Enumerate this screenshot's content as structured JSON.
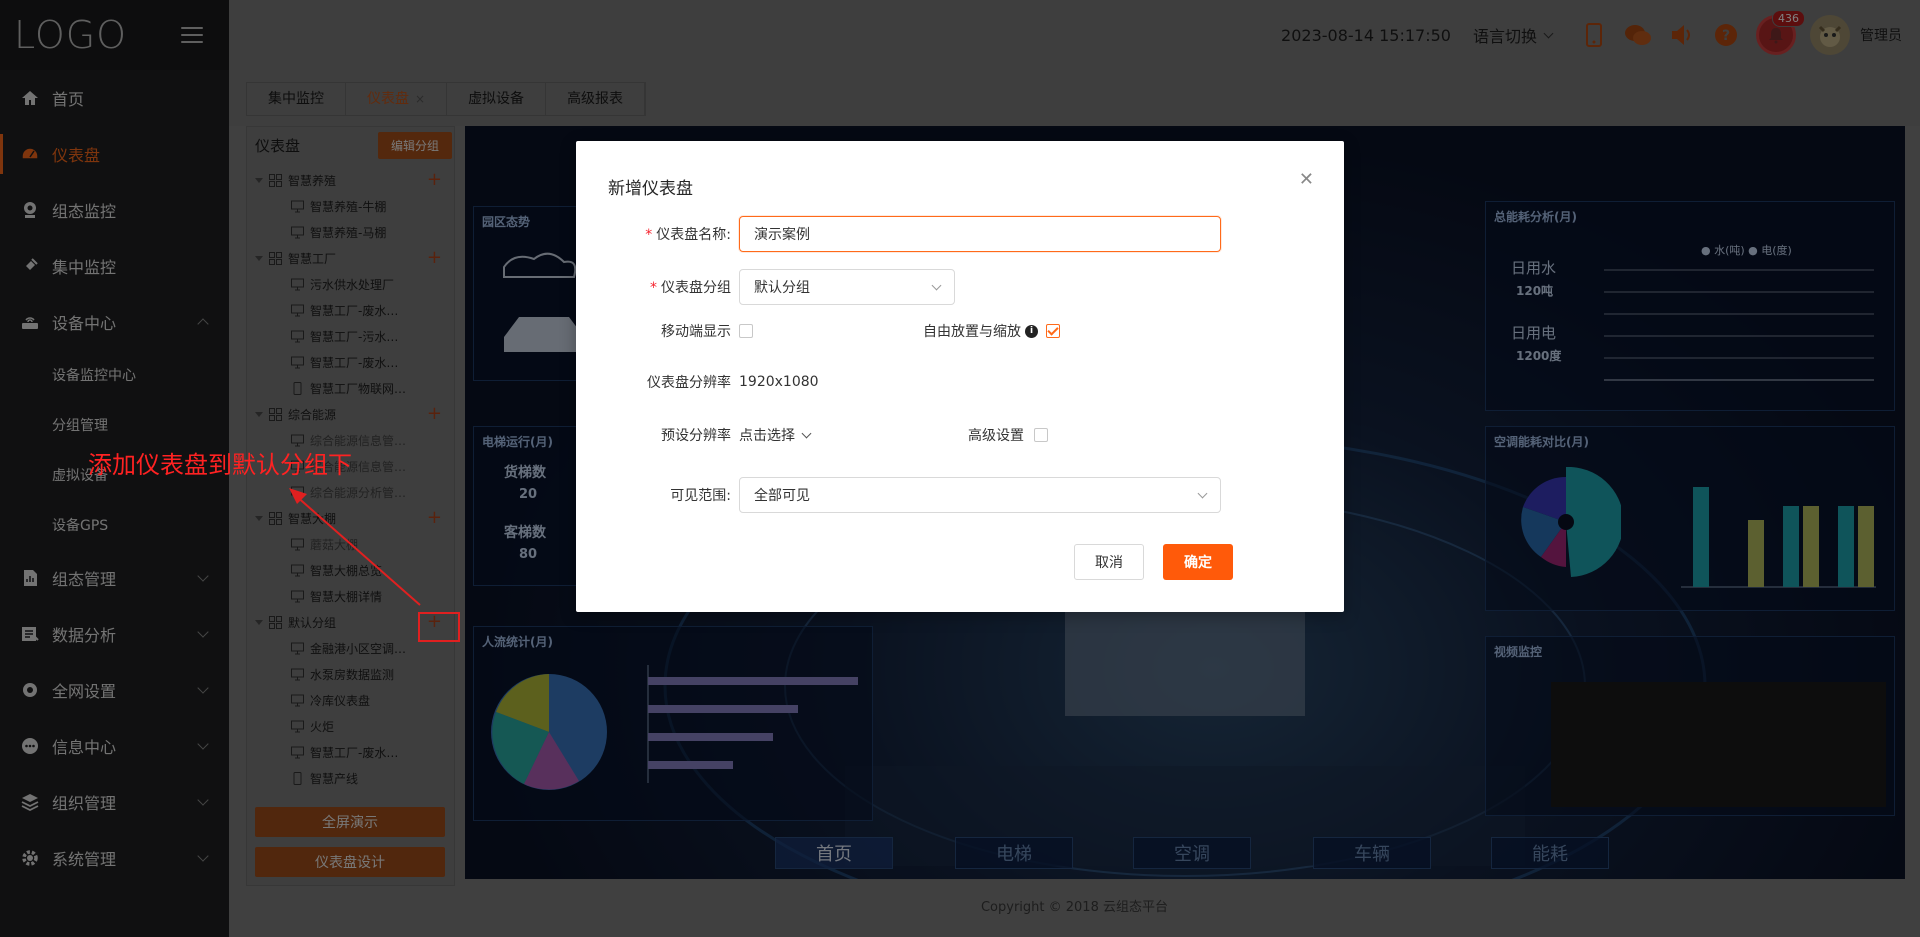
{
  "sidebar": {
    "logo": "LOGO",
    "menu": [
      {
        "label": "首页"
      },
      {
        "label": "仪表盘"
      },
      {
        "label": "组态监控"
      },
      {
        "label": "集中监控"
      },
      {
        "label": "设备中心"
      },
      {
        "label": "组态管理"
      },
      {
        "label": "数据分析"
      },
      {
        "label": "全网设置"
      },
      {
        "label": "信息中心"
      },
      {
        "label": "组织管理"
      },
      {
        "label": "系统管理"
      }
    ],
    "submenu": [
      {
        "label": "设备监控中心"
      },
      {
        "label": "分组管理"
      },
      {
        "label": "虚拟设备"
      },
      {
        "label": "设备GPS"
      }
    ]
  },
  "header": {
    "datetime": "2023-08-14 15:17:50",
    "language": "语言切换",
    "badge_count": "436",
    "user": "管理员"
  },
  "tabs": [
    {
      "label": "集中监控"
    },
    {
      "label": "仪表盘"
    },
    {
      "label": "虚拟设备"
    },
    {
      "label": "高级报表"
    }
  ],
  "tree": {
    "title": "仪表盘",
    "edit_group": "编辑分组",
    "nodes": [
      {
        "label": "智慧养殖"
      },
      {
        "label": "智慧养殖-牛棚"
      },
      {
        "label": "智慧养殖-马棚"
      },
      {
        "label": "智慧工厂"
      },
      {
        "label": "污水供水处理厂"
      },
      {
        "label": "智慧工厂-废水…"
      },
      {
        "label": "智慧工厂-污水…"
      },
      {
        "label": "智慧工厂-废水…"
      },
      {
        "label": "智慧工厂物联网…"
      },
      {
        "label": "综合能源"
      },
      {
        "label": "综合能源信息管…"
      },
      {
        "label": "综合能源信息管…"
      },
      {
        "label": "综合能源分析管…"
      },
      {
        "label": "智慧大棚"
      },
      {
        "label": "蘑菇大棚"
      },
      {
        "label": "智慧大棚总览"
      },
      {
        "label": "智慧大棚详情"
      },
      {
        "label": "默认分组"
      },
      {
        "label": "金融港小区空调…"
      },
      {
        "label": "水泵房数据监测"
      },
      {
        "label": "冷库仪表盘"
      },
      {
        "label": "火炬"
      },
      {
        "label": "智慧工厂-废水…"
      },
      {
        "label": "智慧产线"
      }
    ],
    "fullscreen_btn": "全屏演示",
    "design_btn": "仪表盘设计"
  },
  "annotation": "添加仪表盘到默认分组下",
  "dashboard": {
    "panels": [
      {
        "title": "园区态势"
      },
      {
        "title": "电梯运行(月)"
      },
      {
        "title": "人流统计(月)"
      },
      {
        "title": "总能耗分析(月)"
      },
      {
        "title": "空调能耗对比(月)"
      },
      {
        "title": "视频监控"
      }
    ],
    "elevator": {
      "freight_label": "货梯数",
      "freight_value": "20",
      "passenger_label": "客梯数",
      "passenger_value": "80"
    },
    "energy": {
      "water_label": "日用水",
      "water_value": "120吨",
      "power_label": "日用电",
      "power_value": "1200度",
      "legend": "● 水(吨) ● 电(度)"
    },
    "nav": [
      {
        "label": "首页"
      },
      {
        "label": "电梯"
      },
      {
        "label": "空调"
      },
      {
        "label": "车辆"
      },
      {
        "label": "能耗"
      }
    ]
  },
  "modal": {
    "title": "新增仪表盘",
    "name_label": "仪表盘名称:",
    "name_value": "演示案例",
    "group_label": "仪表盘分组",
    "group_value": "默认分组",
    "mobile_label": "移动端显示",
    "free_label": "自由放置与缩放",
    "resolution_label": "仪表盘分辨率",
    "resolution_value": "1920x1080",
    "preset_label": "预设分辨率",
    "preset_value": "点击选择",
    "advanced_label": "高级设置",
    "visibility_label": "可见范围:",
    "visibility_value": "全部可见",
    "cancel": "取消",
    "ok": "确定"
  },
  "footer": {
    "copyright": "Copyright © 2018 云组态平台"
  },
  "colors": {
    "accent": "#ff6a1a",
    "sidebar": "#202122",
    "danger": "#e02020"
  }
}
